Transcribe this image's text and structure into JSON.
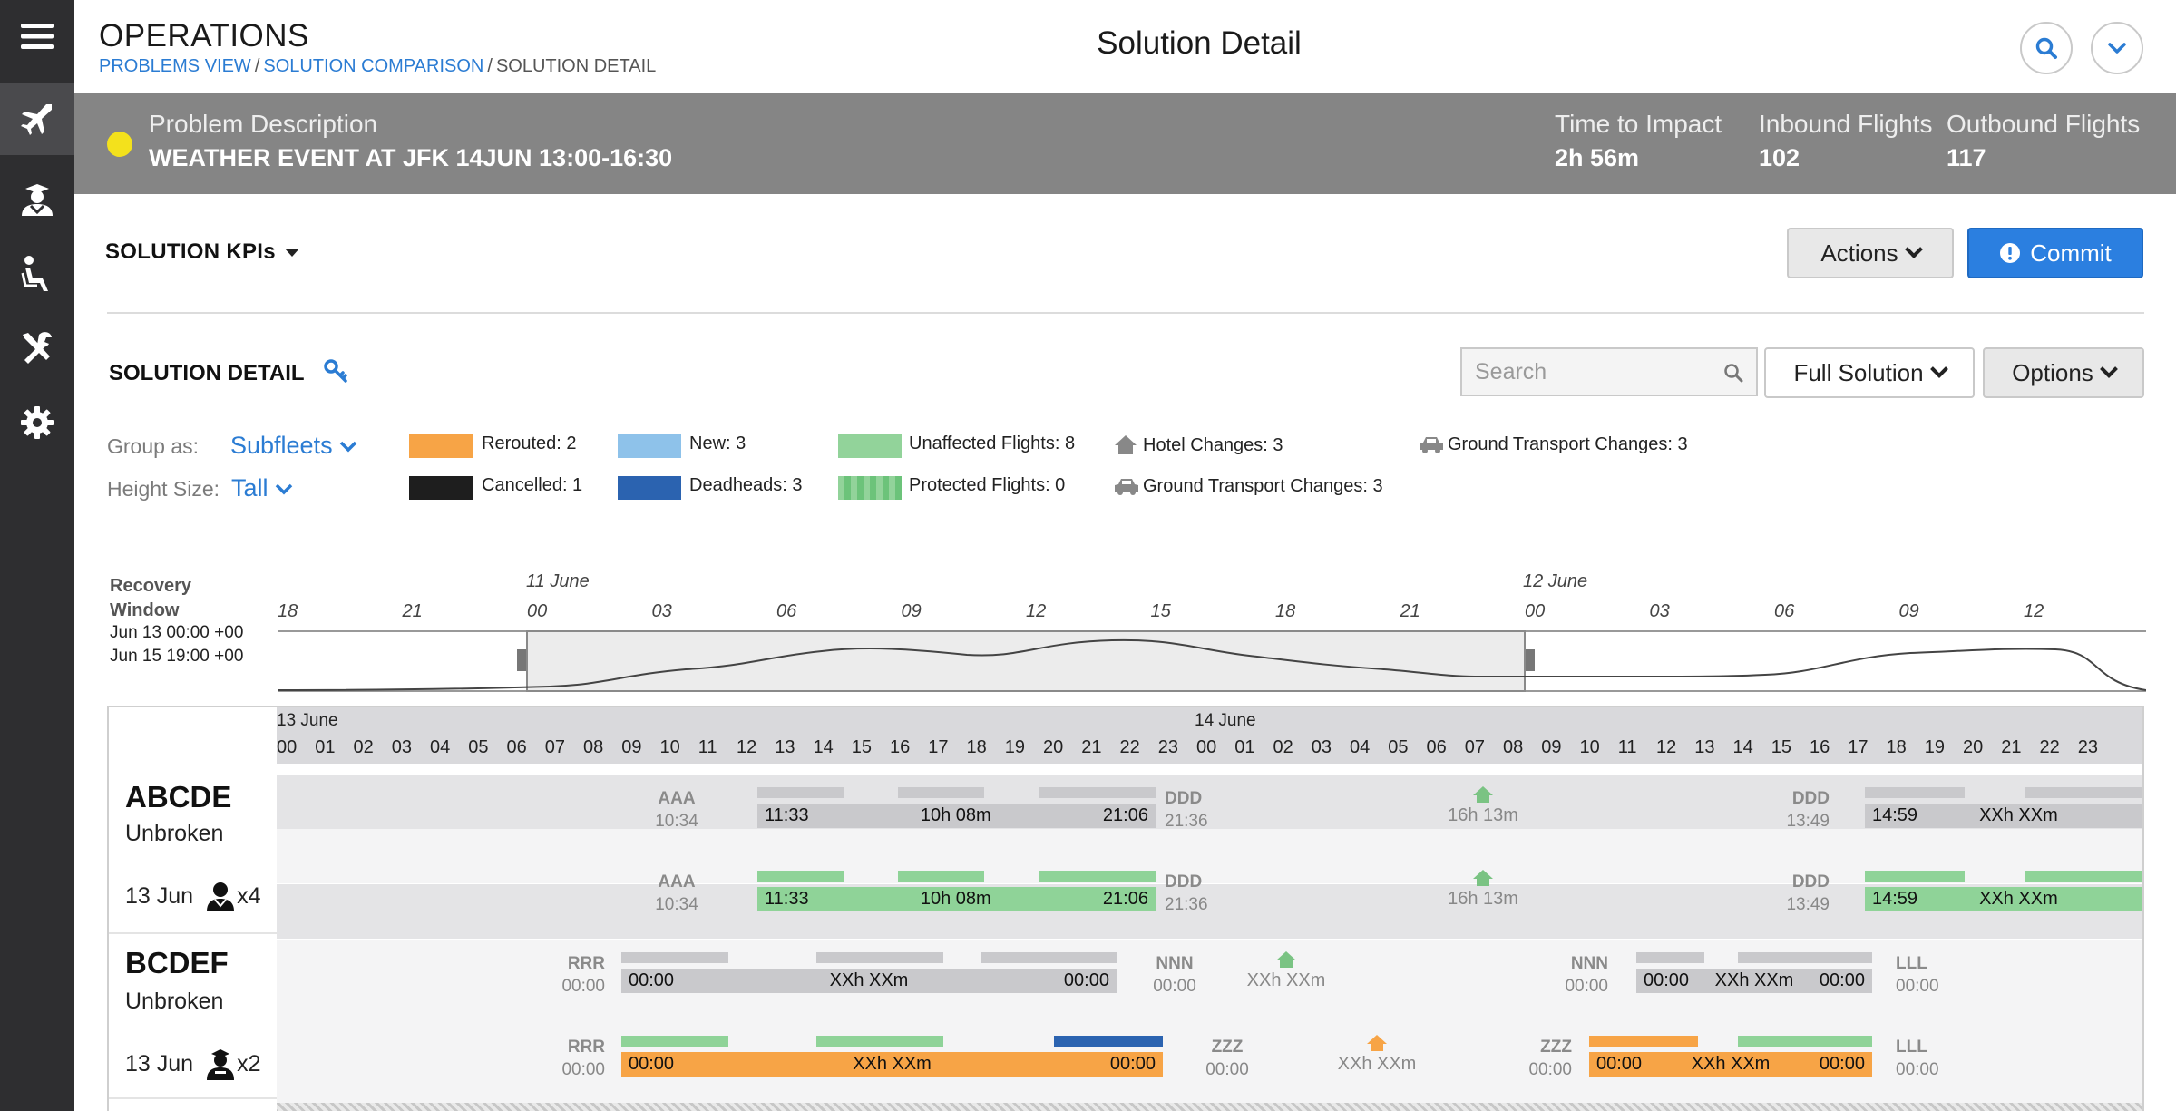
{
  "sidebar": {
    "items": [
      {
        "icon": "menu-icon",
        "active": false
      },
      {
        "icon": "airplane-icon",
        "active": true
      },
      {
        "icon": "crew-icon",
        "active": false
      },
      {
        "icon": "seat-icon",
        "active": false
      },
      {
        "icon": "tools-icon",
        "active": false
      },
      {
        "icon": "gear-icon",
        "active": false
      }
    ]
  },
  "header": {
    "app_title": "OPERATIONS",
    "breadcrumb": [
      "PROBLEMS VIEW",
      "SOLUTION COMPARISON",
      "SOLUTION DETAIL"
    ],
    "breadcrumb_sep": "/",
    "page_title": "Solution Detail"
  },
  "banner": {
    "status_color": "#f3e11c",
    "problem_label": "Problem Description",
    "problem_value": "WEATHER EVENT AT JFK 14JUN 13:00-16:30",
    "time_label": "Time to Impact",
    "time_value": "2h 56m",
    "inbound_label": "Inbound Flights",
    "inbound_value": "102",
    "outbound_label": "Outbound Flights",
    "outbound_value": "117"
  },
  "kpi": {
    "title": "SOLUTION KPIs"
  },
  "actions": {
    "actions_label": "Actions",
    "commit_label": "Commit"
  },
  "detail": {
    "title": "SOLUTION DETAIL",
    "search_placeholder": "Search",
    "full_solution_label": "Full Solution",
    "options_label": "Options",
    "group_label": "Group as:",
    "group_value": "Subfleets",
    "height_label": "Height Size:",
    "height_value": "Tall"
  },
  "legend": {
    "rerouted": {
      "label": "Rerouted: 2",
      "color": "#f7a446"
    },
    "cancelled": {
      "label": "Cancelled: 1",
      "color": "#1e1e1e"
    },
    "new": {
      "label": "New: 3",
      "color": "#8ec2ea"
    },
    "deadheads": {
      "label": "Deadheads: 3",
      "color": "#2b63b0"
    },
    "unaffected": {
      "label": "Unaffected Flights: 8",
      "color": "#92d39a"
    },
    "protected": {
      "label": "Protected Flights: 0",
      "color": "#6cc37a"
    },
    "hotel": {
      "label": "Hotel Changes: 3"
    },
    "ground1": {
      "label": "Ground Transport Changes: 3"
    },
    "ground2": {
      "label": "Ground Transport Changes: 3"
    }
  },
  "recovery": {
    "title_line1": "Recovery",
    "title_line2": "Window",
    "start": "Jun 13 00:00 +00",
    "end": "Jun 15 19:00 +00",
    "day_labels": [
      "11 June",
      "12 June"
    ],
    "ticks": [
      "18",
      "21",
      "00",
      "03",
      "06",
      "09",
      "12",
      "15",
      "18",
      "21",
      "00",
      "03",
      "06",
      "09",
      "12"
    ]
  },
  "timeline": {
    "days": [
      "13 June",
      "14 June"
    ],
    "hours": [
      "00",
      "01",
      "02",
      "03",
      "04",
      "05",
      "06",
      "07",
      "08",
      "09",
      "10",
      "11",
      "12",
      "13",
      "14",
      "15",
      "16",
      "17",
      "18",
      "19",
      "20",
      "21",
      "22",
      "23",
      "00",
      "01",
      "02",
      "03",
      "04",
      "05",
      "06",
      "07",
      "08",
      "09",
      "10",
      "11",
      "12",
      "13",
      "14",
      "15",
      "16",
      "17",
      "18",
      "19",
      "20",
      "21",
      "22",
      "23"
    ]
  },
  "rows": {
    "abcde": {
      "name": "ABCDE",
      "status": "Unbroken",
      "date": "13 Jun",
      "crew_count": "x4",
      "orig_station": "AAA",
      "orig_time": "10:34",
      "flight_dep": "11:33",
      "flight_dur": "10h 08m",
      "flight_arr": "21:06",
      "mid_station": "DDD",
      "mid_time": "21:36",
      "layover": "16h 13m",
      "ret_station": "DDD",
      "ret_time": "13:49",
      "next_dep": "14:59",
      "next_dur": "XXh XXm"
    },
    "abcde2": {
      "orig_station": "AAA",
      "orig_time": "10:34",
      "flight_dep": "11:33",
      "flight_dur": "10h 08m",
      "flight_arr": "21:06",
      "mid_station": "DDD",
      "mid_time": "21:36",
      "layover": "16h 13m",
      "ret_station": "DDD",
      "ret_time": "13:49",
      "next_dep": "14:59",
      "next_dur": "XXh XXm"
    },
    "bcdef": {
      "name": "BCDEF",
      "status": "Unbroken",
      "date": "13 Jun",
      "crew_count": "x2",
      "orig_station": "RRR",
      "orig_time": "00:00",
      "flight_dep": "00:00",
      "flight_dur": "XXh XXm",
      "flight_arr": "00:00",
      "mid_station": "NNN",
      "mid_time": "00:00",
      "layover": "XXh XXm",
      "ret_station": "NNN",
      "ret_time": "00:00",
      "next_dep": "00:00",
      "next_dur": "XXh XXm",
      "next_arr": "00:00",
      "end_station": "LLL",
      "end_time": "00:00"
    },
    "bcdef2": {
      "orig_station": "RRR",
      "orig_time": "00:00",
      "flight_dep": "00:00",
      "flight_dur": "XXh XXm",
      "flight_arr": "00:00",
      "mid_station": "ZZZ",
      "mid_time": "00:00",
      "layover": "XXh XXm",
      "ret_station": "ZZZ",
      "ret_time": "00:00",
      "next_dep": "00:00",
      "next_dur": "XXh XXm",
      "next_arr": "00:00",
      "end_station": "LLL",
      "end_time": "00:00"
    }
  }
}
